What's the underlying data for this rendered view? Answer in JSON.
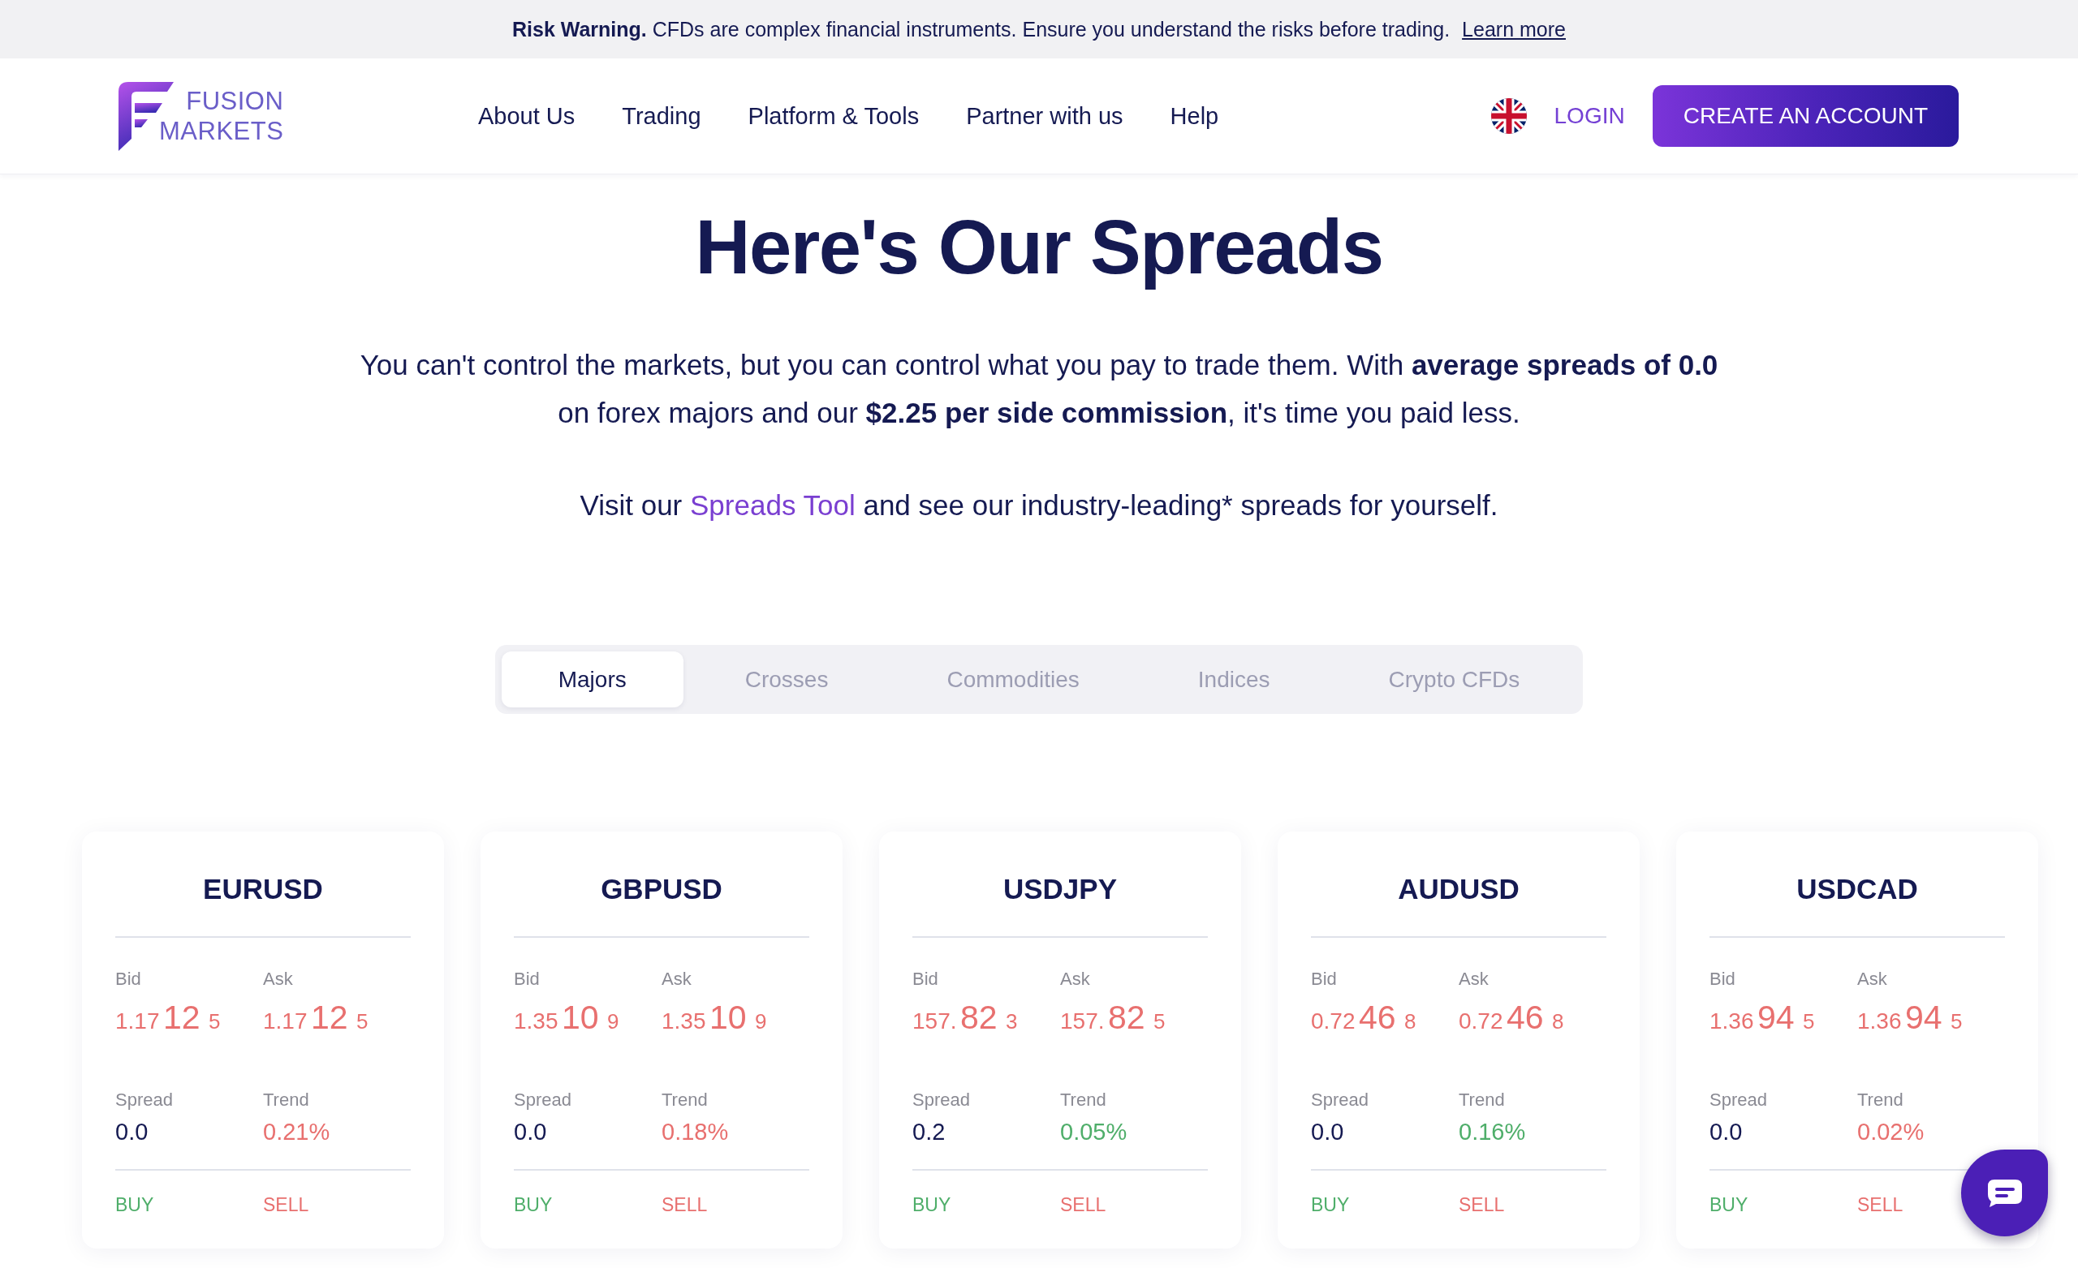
{
  "risk_banner": {
    "text": "**Risk Warning.** CFDs are complex financial instruments. Ensure you understand the risks before trading.",
    "link": "Learn more"
  },
  "header": {
    "logo": {
      "line_1": "FUSION",
      "line_2": "MARKETS"
    },
    "nav": [
      "About Us",
      "Trading",
      "Platform & Tools",
      "Partner with us",
      "Help"
    ],
    "login": "LOGIN",
    "cta": "CREATE AN ACCOUNT"
  },
  "hero": {
    "title": "Here's Our Spreads",
    "intro": "You can't control the markets, but you can control what you pay to trade them. With **average spreads of 0.0** on forex majors and our **$2.25 per side commission**, it's time you paid less.",
    "tool_text": {
      "before": "Visit our",
      "link": "Spreads Tool",
      "after": "and see our industry-leading* spreads for yourself."
    }
  },
  "tabs": [
    {
      "label": "Majors",
      "selected": true
    },
    {
      "label": "Crosses",
      "selected": false
    },
    {
      "label": "Commodities",
      "selected": false
    },
    {
      "label": "Indices",
      "selected": false
    },
    {
      "label": "Crypto CFDs",
      "selected": false
    }
  ],
  "cards": [
    {
      "symbol": "EURUSD",
      "bid_label": "Bid",
      "bid": {
        "big_figure": "1.17",
        "pips": "12",
        "fraction": "5"
      },
      "ask_label": "Ask",
      "ask": {
        "big_figure": "1.17",
        "pips": "12",
        "fraction": "5"
      },
      "spread_label": "Spread",
      "spread": "0.0",
      "trend_label": "Trend",
      "trend": {
        "value": "0.21%",
        "color": "#e8706f"
      },
      "buy": "BUY",
      "sell": "SELL"
    },
    {
      "symbol": "GBPUSD",
      "bid_label": "Bid",
      "bid": {
        "big_figure": "1.35",
        "pips": "10",
        "fraction": "9"
      },
      "ask_label": "Ask",
      "ask": {
        "big_figure": "1.35",
        "pips": "10",
        "fraction": "9"
      },
      "spread_label": "Spread",
      "spread": "0.0",
      "trend_label": "Trend",
      "trend": {
        "value": "0.18%",
        "color": "#e8706f"
      },
      "buy": "BUY",
      "sell": "SELL"
    },
    {
      "symbol": "USDJPY",
      "bid_label": "Bid",
      "bid": {
        "big_figure": "157.",
        "pips": "82",
        "fraction": "3"
      },
      "ask_label": "Ask",
      "ask": {
        "big_figure": "157.",
        "pips": "82",
        "fraction": "5"
      },
      "spread_label": "Spread",
      "spread": "0.2",
      "trend_label": "Trend",
      "trend": {
        "value": "0.05%",
        "color": "#4fae6a"
      },
      "buy": "BUY",
      "sell": "SELL"
    },
    {
      "symbol": "AUDUSD",
      "bid_label": "Bid",
      "bid": {
        "big_figure": "0.72",
        "pips": "46",
        "fraction": "8"
      },
      "ask_label": "Ask",
      "ask": {
        "big_figure": "0.72",
        "pips": "46",
        "fraction": "8"
      },
      "spread_label": "Spread",
      "spread": "0.0",
      "trend_label": "Trend",
      "trend": {
        "value": "0.16%",
        "color": "#4fae6a"
      },
      "buy": "BUY",
      "sell": "SELL"
    },
    {
      "symbol": "USDCAD",
      "bid_label": "Bid",
      "bid": {
        "big_figure": "1.36",
        "pips": "94",
        "fraction": "5"
      },
      "ask_label": "Ask",
      "ask": {
        "big_figure": "1.36",
        "pips": "94",
        "fraction": "5"
      },
      "spread_label": "Spread",
      "spread": "0.0",
      "trend_label": "Trend",
      "trend": {
        "value": "0.02%",
        "color": "#e8706f"
      },
      "buy": "BUY",
      "sell": "SELL"
    }
  ]
}
